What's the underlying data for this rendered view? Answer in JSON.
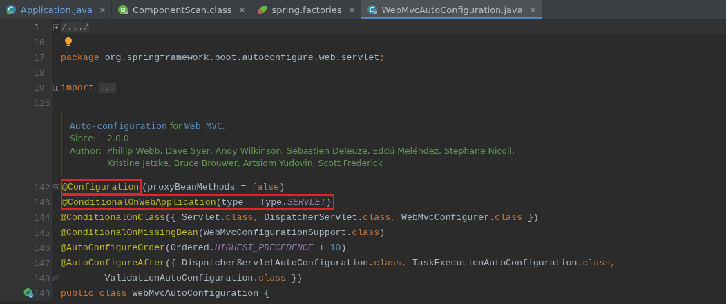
{
  "tabs": [
    {
      "label": "Application.java",
      "color": "#6e9fd8",
      "selected": false
    },
    {
      "label": "ComponentScan.class",
      "color": "#bbbbbb",
      "selected": false
    },
    {
      "label": "spring.factories",
      "color": "#bbbbbb",
      "selected": false
    },
    {
      "label": "WebMvcAutoConfiguration.java",
      "color": "#bbbbbb",
      "selected": true
    }
  ],
  "lines": [
    {
      "kind": "code",
      "number": "1",
      "current": true,
      "collapsed": true,
      "tokens": [
        {
          "text": "/.../",
          "kind": "folded"
        }
      ]
    },
    {
      "kind": "code",
      "number": "16",
      "current": false,
      "bulb": true
    },
    {
      "kind": "code",
      "number": "17",
      "current": false,
      "tokens": [
        {
          "text": "package ",
          "kind": "keyword"
        },
        {
          "text": "org.springframework.boot.autoconfigure.web.servlet",
          "kind": "plain"
        },
        {
          "text": ";",
          "kind": "keyword"
        }
      ]
    },
    {
      "kind": "code",
      "number": "18",
      "current": false
    },
    {
      "kind": "code",
      "number": "19",
      "current": false,
      "collapsed": true,
      "tokens": [
        {
          "text": "import ",
          "kind": "keyword"
        },
        {
          "text": "...",
          "kind": "folded"
        }
      ]
    },
    {
      "kind": "code",
      "number": "126",
      "current": false
    },
    {
      "kind": "doc",
      "summary": [
        {
          "text": "Auto-configuration",
          "kind": "code"
        },
        {
          "text": " for ",
          "kind": "text"
        },
        {
          "text": "Web MVC",
          "kind": "code"
        },
        {
          "text": ".",
          "kind": "text"
        }
      ],
      "since_label": "Since:",
      "since": "2.0.0",
      "author_label": "Author:",
      "authors": [
        "Phillip Webb, Dave Syer, Andy Wilkinson, Sébastien Deleuze, Eddú Meléndez, Stephane Nicoll,",
        "Kristine Jetzke, Bruce Brouwer, Artsiom Yudovin, Scott Frederick"
      ]
    },
    {
      "kind": "code",
      "number": "142",
      "current": false,
      "fold_start": true,
      "tokens": [
        {
          "text": "@Configuration",
          "kind": "annotation",
          "boxed": true
        },
        {
          "text": "(proxyBeanMethods = ",
          "kind": "plain"
        },
        {
          "text": "false",
          "kind": "keyword"
        },
        {
          "text": ")",
          "kind": "plain"
        }
      ]
    },
    {
      "kind": "code",
      "number": "143",
      "current": false,
      "tokens": [
        {
          "text": "@ConditionalOnWebApplication",
          "kind": "annotation",
          "boxed": true
        },
        {
          "text": "(type = Type.",
          "kind": "plain",
          "boxed": true
        },
        {
          "text": "SERVLET",
          "kind": "constant",
          "boxed": true
        },
        {
          "text": ")",
          "kind": "plain",
          "boxed": true
        }
      ]
    },
    {
      "kind": "code",
      "number": "144",
      "current": false,
      "tokens": [
        {
          "text": "@ConditionalOnClass",
          "kind": "annotation"
        },
        {
          "text": "({ Servlet.",
          "kind": "plain"
        },
        {
          "text": "class, ",
          "kind": "keyword"
        },
        {
          "text": "DispatcherServlet.",
          "kind": "plain"
        },
        {
          "text": "class, ",
          "kind": "keyword"
        },
        {
          "text": "WebMvcConfigurer.",
          "kind": "plain"
        },
        {
          "text": "class ",
          "kind": "keyword"
        },
        {
          "text": "})",
          "kind": "plain"
        }
      ]
    },
    {
      "kind": "code",
      "number": "145",
      "current": false,
      "tokens": [
        {
          "text": "@ConditionalOnMissingBean",
          "kind": "annotation"
        },
        {
          "text": "(WebMvcConfigurationSupport.",
          "kind": "plain"
        },
        {
          "text": "class",
          "kind": "keyword"
        },
        {
          "text": ")",
          "kind": "plain"
        }
      ]
    },
    {
      "kind": "code",
      "number": "146",
      "current": false,
      "tokens": [
        {
          "text": "@AutoConfigureOrder",
          "kind": "annotation"
        },
        {
          "text": "(Ordered.",
          "kind": "plain"
        },
        {
          "text": "HIGHEST_PRECEDENCE",
          "kind": "constant"
        },
        {
          "text": " + ",
          "kind": "plain"
        },
        {
          "text": "10",
          "kind": "number"
        },
        {
          "text": ")",
          "kind": "plain"
        }
      ]
    },
    {
      "kind": "code",
      "number": "147",
      "current": false,
      "tokens": [
        {
          "text": "@AutoConfigureAfter",
          "kind": "annotation"
        },
        {
          "text": "({ DispatcherServletAutoConfiguration.",
          "kind": "plain"
        },
        {
          "text": "class, ",
          "kind": "keyword"
        },
        {
          "text": "TaskExecutionAutoConfiguration.",
          "kind": "plain"
        },
        {
          "text": "class,",
          "kind": "keyword"
        }
      ]
    },
    {
      "kind": "code",
      "number": "148",
      "current": false,
      "fold_end": true,
      "tokens": [
        {
          "text": "        ValidationAutoConfiguration.",
          "kind": "plain"
        },
        {
          "text": "class ",
          "kind": "keyword"
        },
        {
          "text": "})",
          "kind": "plain"
        }
      ]
    },
    {
      "kind": "code",
      "number": "149",
      "current": false,
      "bean_marker": true,
      "tokens": [
        {
          "text": "public class ",
          "kind": "keyword"
        },
        {
          "text": "WebMvcAutoConfiguration {",
          "kind": "plain"
        }
      ]
    }
  ]
}
